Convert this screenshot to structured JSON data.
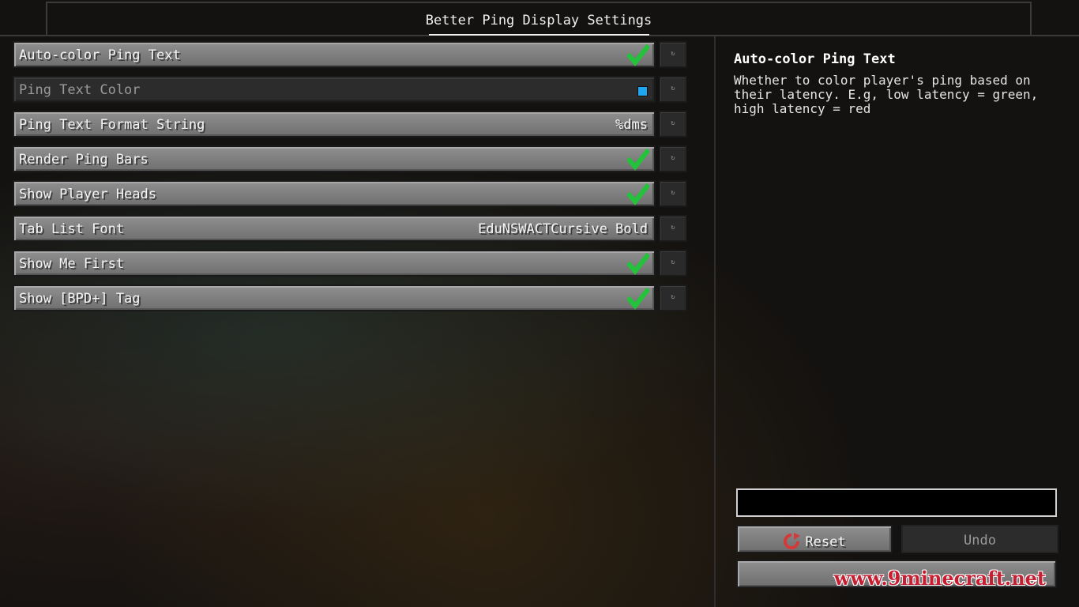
{
  "header": {
    "title": "Better Ping Display Settings"
  },
  "settings": [
    {
      "label": "Auto-color Ping Text",
      "type": "toggle",
      "value": "",
      "checked": true,
      "disabled": false
    },
    {
      "label": "Ping Text Color",
      "type": "color",
      "value": "",
      "color": "#1fa6f0",
      "disabled": true
    },
    {
      "label": "Ping Text Format String",
      "type": "text",
      "value": "%dms",
      "disabled": false
    },
    {
      "label": "Render Ping Bars",
      "type": "toggle",
      "value": "",
      "checked": true,
      "disabled": false
    },
    {
      "label": "Show Player Heads",
      "type": "toggle",
      "value": "",
      "checked": true,
      "disabled": false
    },
    {
      "label": "Tab List Font",
      "type": "text",
      "value": "EduNSWACTCursive Bold",
      "disabled": false
    },
    {
      "label": "Show Me First",
      "type": "toggle",
      "value": "",
      "checked": true,
      "disabled": false
    },
    {
      "label": "Show [BPD+] Tag",
      "type": "toggle",
      "value": "",
      "checked": true,
      "disabled": false
    }
  ],
  "row_reset_glyph": "↻",
  "description": {
    "title": "Auto-color Ping Text",
    "text": "Whether to color player's ping based on their latency.  E.g, low latency = green, high latency = red"
  },
  "search": {
    "value": ""
  },
  "buttons": {
    "reset": "Reset",
    "undo": "Undo"
  },
  "watermark": "www.9minecraft.net",
  "colors": {
    "check": "#22c33a",
    "reset_icon": "#d43a3a"
  }
}
